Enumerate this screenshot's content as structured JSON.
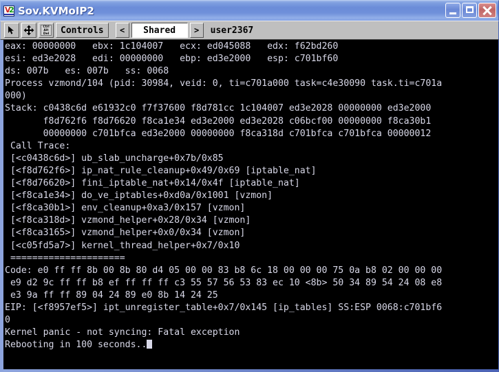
{
  "window": {
    "title": "Sov.KVMoIP2",
    "icon": "v2-logo-icon",
    "buttons": {
      "minimize": "minimize-button",
      "maximize": "maximize-button",
      "close": "close-button"
    },
    "colors": {
      "titlebar_blue": "#6b8cd8",
      "toolbar_gray": "#bfbfbf",
      "terminal_bg": "#000000",
      "terminal_fg": "#d8d8e8",
      "close_red": "#c06666",
      "frame_blue": "#5a76c8"
    }
  },
  "toolbar": {
    "pointer_icon": "mouse-pointer-icon",
    "move_icon": "four-way-move-icon",
    "cad_icon_lines": [
      "Ctrl",
      "Alt",
      "Del"
    ],
    "controls_label": "Controls",
    "prev_label": "<",
    "session_value": "Shared",
    "next_label": ">",
    "user_label": "user2367"
  },
  "terminal": {
    "lines": [
      "eax: 00000000   ebx: 1c104007   ecx: ed045088   edx: f62bd260",
      "esi: ed3e2028   edi: 00000000   ebp: ed3e2000   esp: c701bf60",
      "ds: 007b   es: 007b   ss: 0068",
      "Process vzmond/104 (pid: 30984, veid: 0, ti=c701a000 task=c4e30090 task.ti=c701a",
      "000)",
      "Stack: c0438c6d e61932c0 f7f37600 f8d781cc 1c104007 ed3e2028 00000000 ed3e2000",
      "       f8d762f6 f8d76620 f8ca1e34 ed3e2000 ed3e2028 c06bcf00 00000000 f8ca30b1",
      "       00000000 c701bfca ed3e2000 00000000 f8ca318d c701bfca c701bfca 00000012",
      " Call Trace:",
      " [<c0438c6d>] ub_slab_uncharge+0x7b/0x85",
      " [<f8d762f6>] ip_nat_rule_cleanup+0x49/0x69 [iptable_nat]",
      " [<f8d76620>] fini_iptable_nat+0x14/0x4f [iptable_nat]",
      " [<f8ca1e34>] do_ve_iptables+0xd0a/0x1001 [vzmon]",
      " [<f8ca30b1>] env_cleanup+0xa3/0x157 [vzmon]",
      " [<f8ca318d>] vzmond_helper+0x28/0x34 [vzmon]",
      " [<f8ca3165>] vzmond_helper+0x0/0x34 [vzmon]",
      " [<c05fd5a7>] kernel_thread_helper+0x7/0x10",
      " =====================",
      "Code: e0 ff ff 8b 00 8b 80 d4 05 00 00 83 b8 6c 18 00 00 00 75 0a b8 02 00 00 00",
      " e9 d2 9c ff ff b8 ef ff ff ff c3 55 57 56 53 83 ec 10 <8b> 50 34 89 54 24 08 e8",
      " e3 9a ff ff 89 04 24 89 e0 8b 14 24 25",
      "EIP: [<f8957ef5>] ipt_unregister_table+0x7/0x145 [ip_tables] SS:ESP 0068:c701bf6",
      "0",
      "Kernel panic - not syncing: Fatal exception",
      "Rebooting in 100 seconds.."
    ],
    "cursor_after_last_line": true
  }
}
